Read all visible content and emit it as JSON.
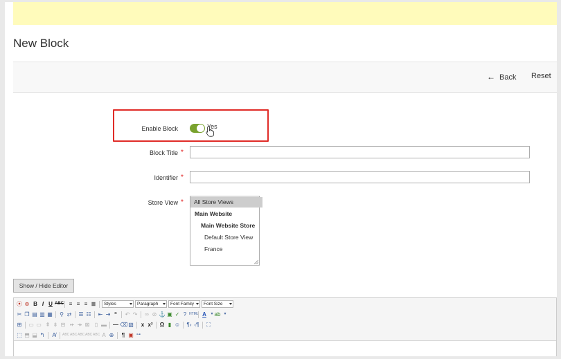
{
  "page": {
    "title": "New Block"
  },
  "actions": {
    "back_label": "Back",
    "reset_label": "Reset"
  },
  "form": {
    "enable_block": {
      "label": "Enable Block",
      "value": "Yes",
      "enabled": true
    },
    "block_title": {
      "label": "Block Title",
      "required_mark": "*",
      "value": ""
    },
    "identifier": {
      "label": "Identifier",
      "required_mark": "*",
      "value": ""
    },
    "store_view": {
      "label": "Store View",
      "required_mark": "*",
      "options": [
        "All Store Views",
        "Main Website",
        "Main Website Store",
        "Default Store View",
        "France"
      ],
      "selected": "All Store Views"
    }
  },
  "editor": {
    "toggle_label": "Show / Hide Editor",
    "toolbar": {
      "styles": "Styles",
      "paragraph": "Paragraph",
      "font_family": "Font Family",
      "font_size": "Font Size"
    }
  },
  "colors": {
    "toggle_on": "#79a22e",
    "highlight": "#e02b27",
    "required": "#e22626",
    "notice": "#fffbbb"
  }
}
